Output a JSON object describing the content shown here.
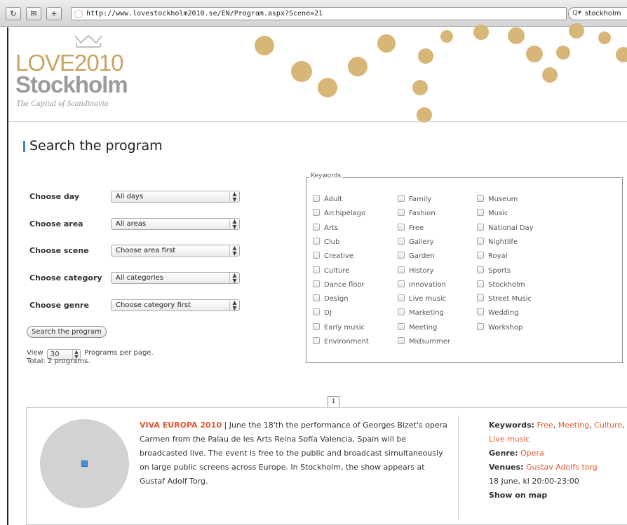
{
  "browser": {
    "url": "http://www.lovestockholm2010.se/EN/Program.aspx?Scene=21",
    "search_query": "stockholm",
    "back_icon": "reload-icon",
    "colors": {
      "rss": "#e3651d"
    }
  },
  "header": {
    "logo_line1": "LOVE2010",
    "logo_line2": "Stockholm",
    "tagline": "The Capital of Scandinavia",
    "dot_color": "#d7b678",
    "logo_gold": "#c9a366"
  },
  "section": {
    "title": "Search the program",
    "accent": "#3d83c2"
  },
  "filters": [
    {
      "label": "Choose day",
      "value": "All days"
    },
    {
      "label": "Choose area",
      "value": "All areas"
    },
    {
      "label": "Choose scene",
      "value": "Choose area first"
    },
    {
      "label": "Choose category",
      "value": "All categories"
    },
    {
      "label": "Choose genre",
      "value": "Choose category first"
    }
  ],
  "search_button": "Search the program",
  "view": {
    "prefix": "View",
    "per_page": "30",
    "suffix": "Programs per page."
  },
  "total": "Total: 2 programs.",
  "keywords": {
    "legend": "Keywords",
    "col1": [
      "Adult",
      "Archipelago",
      "Arts",
      "Club",
      "Creative",
      "Culture",
      "Dance floor",
      "Design",
      "DJ",
      "Early music",
      "Environment"
    ],
    "col2": [
      "Family",
      "Fashion",
      "Free",
      "Gallery",
      "Garden",
      "History",
      "Innovation",
      "Live music",
      "Marketing",
      "Meeting",
      "Midsummer"
    ],
    "col3": [
      "Museum",
      "Music",
      "National Day",
      "Nightlife",
      "Royal",
      "Sports",
      "Stockholm",
      "Street Music",
      "Wedding",
      "Workshop"
    ]
  },
  "pagination": {
    "current": "1"
  },
  "result": {
    "title": "VIVA EUROPA 2010",
    "separator": " | ",
    "description": "June the 18'th the performance of Georges Bizet's opera Carmen from the Palau de les Arts Reina Sofía Valencia, Spain will be broadcasted live. The event is free to the public and broadcast simultaneously on large public screens across Europe. In Stockholm, the show appears at Gustaf Adolf Torg.",
    "keywords_label": "Keywords:",
    "keywords": [
      "Free",
      "Meeting",
      "Culture",
      "Live music"
    ],
    "genre_label": "Genre:",
    "genre": "Opera",
    "venues_label": "Venues:",
    "venue": "Gustav Adolfs torg",
    "datetime": "18 June, kl 20:00-23:00",
    "map_link": "Show on map",
    "link_color": "#e05a32"
  }
}
